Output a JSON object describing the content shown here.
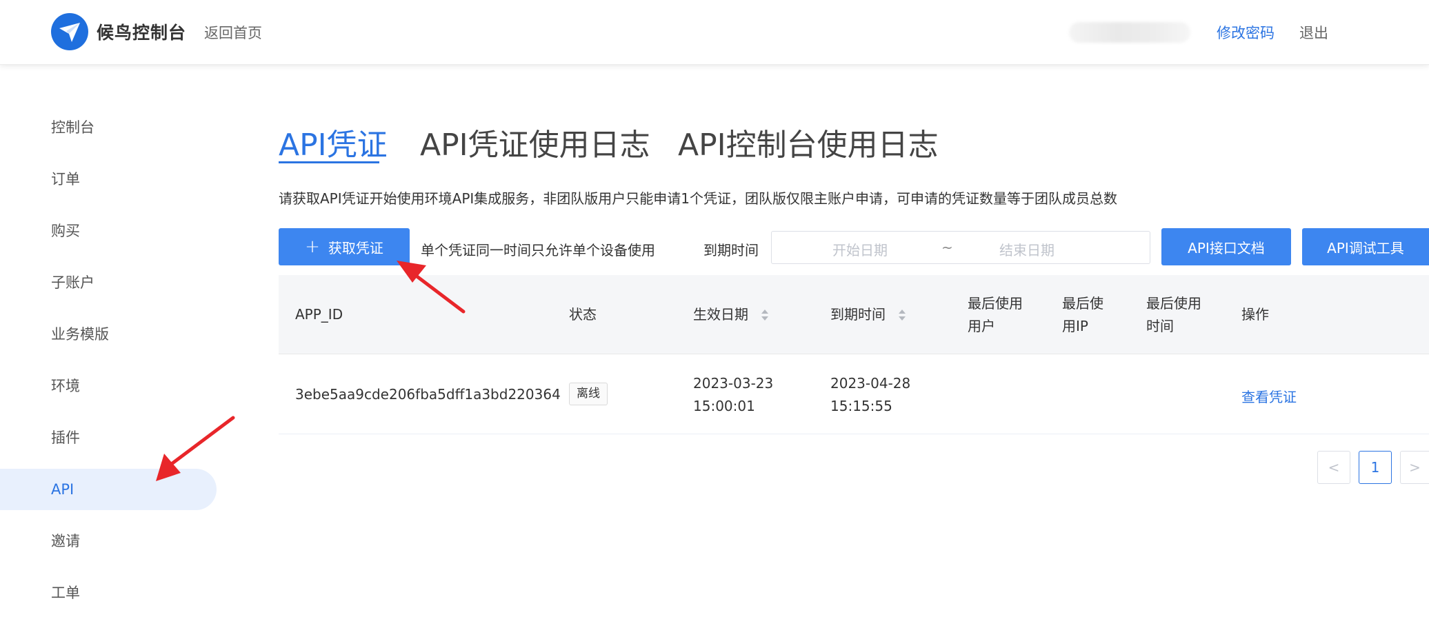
{
  "header": {
    "logo_text": "候鸟控制台",
    "back_home": "返回首页",
    "change_password": "修改密码",
    "logout": "退出"
  },
  "sidebar": {
    "items": [
      {
        "label": "控制台"
      },
      {
        "label": "订单"
      },
      {
        "label": "购买"
      },
      {
        "label": "子账户"
      },
      {
        "label": "业务模版"
      },
      {
        "label": "环境"
      },
      {
        "label": "插件"
      },
      {
        "label": "API",
        "active": true
      },
      {
        "label": "邀请"
      },
      {
        "label": "工单"
      }
    ]
  },
  "main": {
    "tabs": [
      {
        "label": "API凭证",
        "active": true
      },
      {
        "label": "API凭证使用日志"
      },
      {
        "label": "API控制台使用日志"
      }
    ],
    "description": "请获取API凭证开始使用环境API集成服务，非团队版用户只能申请1个凭证，团队版仅限主账户申请，可申请的凭证数量等于团队成员总数",
    "toolbar": {
      "get_credential": "获取凭证",
      "single_device_note": "单个凭证同一时间只允许单个设备使用",
      "expire_label": "到期时间",
      "start_date_placeholder": "开始日期",
      "date_separator": "~",
      "end_date_placeholder": "结束日期",
      "api_docs": "API接口文档",
      "api_debug": "API调试工具"
    },
    "table": {
      "columns": {
        "app_id": "APP_ID",
        "status": "状态",
        "effective_date": "生效日期",
        "expire_time": "到期时间",
        "last_user_1": "最后使用",
        "last_user_2": "用户",
        "last_ip_1": "最后使",
        "last_ip_2": "用IP",
        "last_time_1": "最后使用",
        "last_time_2": "时间",
        "action": "操作"
      },
      "rows": [
        {
          "app_id": "3ebe5aa9cde206fba5dff1a3bd220364",
          "status": "离线",
          "effective_date": "2023-03-23",
          "effective_time": "15:00:01",
          "expire_date": "2023-04-28",
          "expire_time": "15:15:55",
          "action": "查看凭证"
        }
      ]
    },
    "pagination": {
      "prev": "<",
      "current": "1",
      "next": ">"
    }
  },
  "colors": {
    "accent": "#2b74e2",
    "button": "#3d86f0",
    "annotation_arrow": "#e8262a"
  }
}
